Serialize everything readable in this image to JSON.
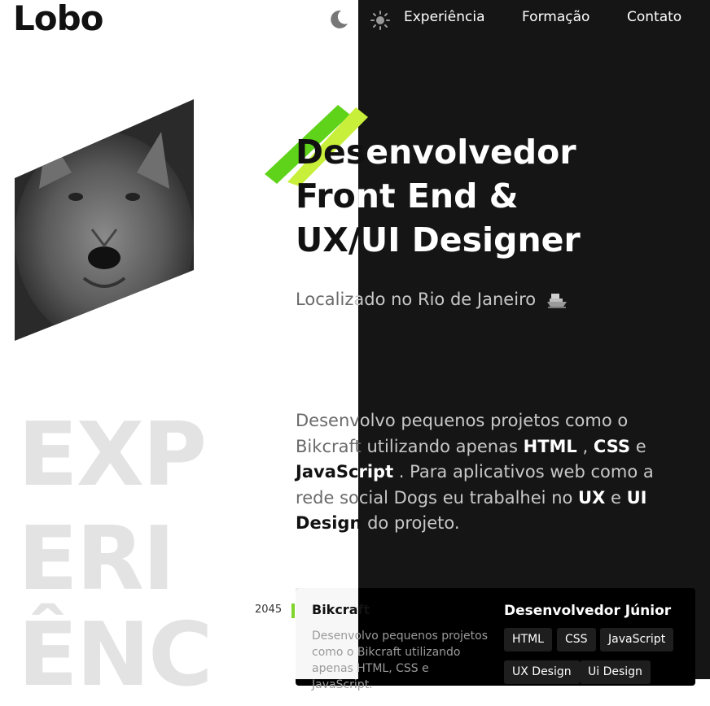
{
  "header": {
    "logo": "Lobo",
    "theme_dark_icon": "moon-icon",
    "theme_light_icon": "sun-icon",
    "nav": [
      "Experiência",
      "Formação",
      "Contato"
    ]
  },
  "hero": {
    "title_lines": [
      "Desenvolvedor",
      "Front End &",
      "UX/UI Designer"
    ],
    "location": "Localizado no Rio de Janeiro",
    "location_icon": "boat-icon",
    "accent_color": "#80d42c"
  },
  "background_text": [
    "EXP",
    "ERI",
    "ÊNC"
  ],
  "about": {
    "p1": "Desenvolvo pequenos projetos como o",
    "p2a": "Bikcraft utilizando apenas ",
    "html": "HTML",
    "p2b": " , ",
    "css": "CSS",
    "p2c": " e",
    "js": "JavaScript",
    "p3": " . Para aplicativos web como a",
    "p4a": "rede social Dogs eu trabalhei no ",
    "ux": "UX",
    "p4b": " e ",
    "ui": "UI",
    "design": "Design",
    "p5": " do projeto."
  },
  "experience": {
    "year": "2045",
    "project": "Bikcraft",
    "description": "Desenvolvo pequenos projetos como o Bikcraft utilizando apenas HTML, CSS e JavaScript.",
    "role": "Desenvolvedor Júnior",
    "tags": [
      "HTML",
      "CSS",
      "JavaScript",
      "UX Design",
      "Ui Design"
    ]
  }
}
